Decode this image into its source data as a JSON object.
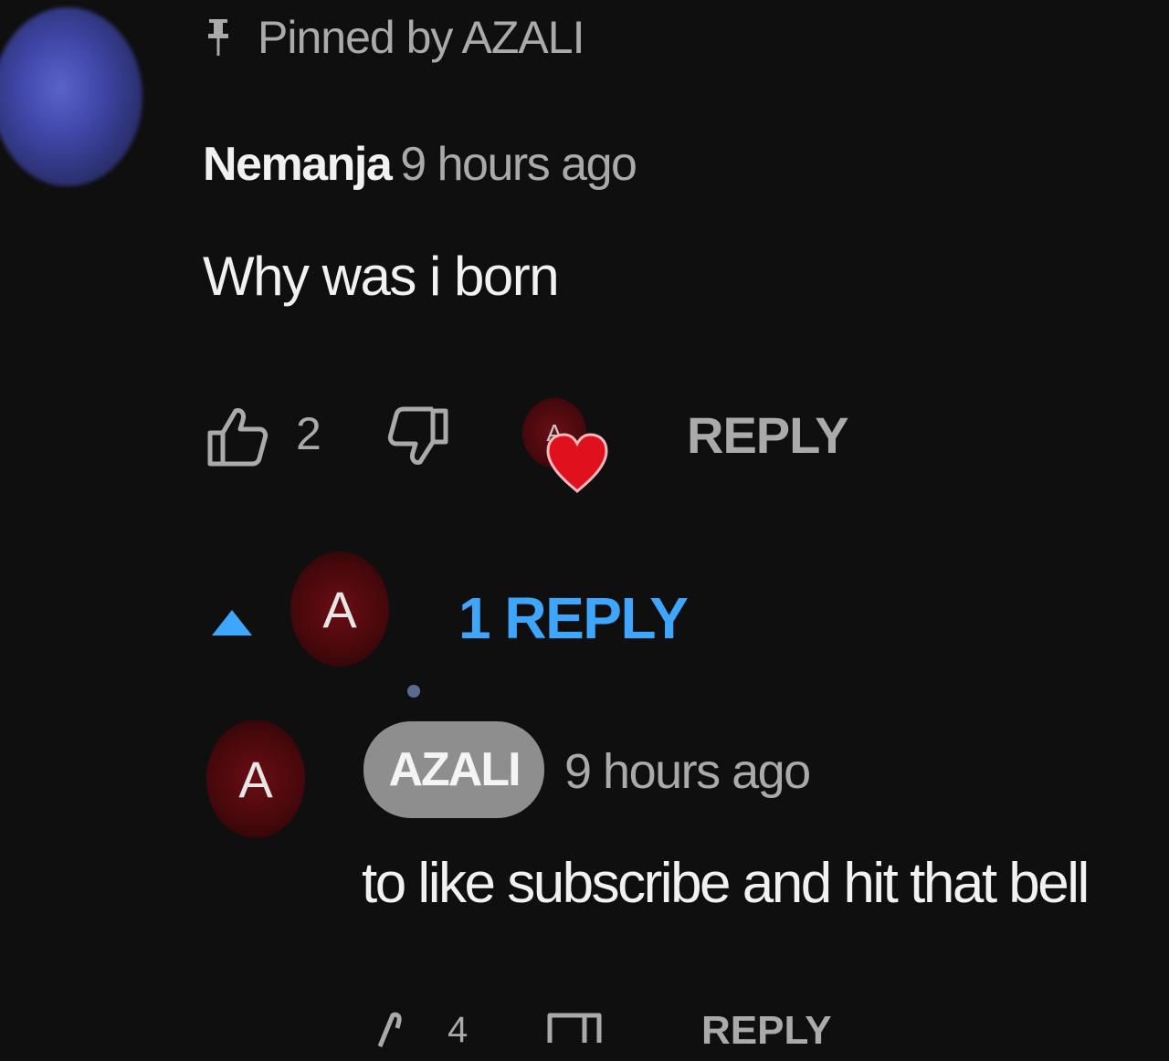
{
  "pinned": {
    "text": "Pinned by AZALI",
    "icon": "pin-icon"
  },
  "comment": {
    "author": "Nemanja",
    "time": "9 hours ago",
    "text": "Why was i born",
    "likes": "2",
    "heart_avatar_letter": "A",
    "reply_label": "REPLY"
  },
  "replies": {
    "avatar_letter": "A",
    "toggle_label": "1 REPLY"
  },
  "reply": {
    "avatar_letter": "A",
    "author": "AZALI",
    "time": "9 hours ago",
    "text": "to like subscribe and hit that bell",
    "likes": "4",
    "reply_label": "REPLY"
  },
  "colors": {
    "background": "#0f0f0f",
    "link_blue": "#3ea6ff",
    "heart_red": "#e0101c",
    "muted_text": "#aaaaaa"
  }
}
